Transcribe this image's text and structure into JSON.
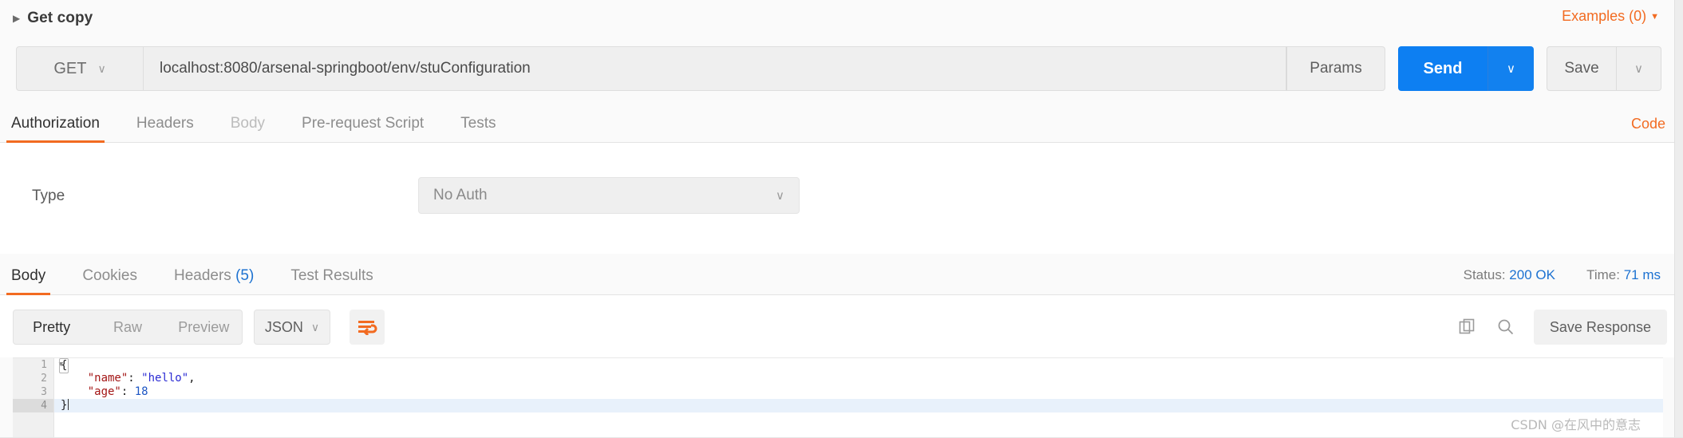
{
  "request": {
    "title": "Get copy",
    "collapse_caret": "▶",
    "examples_label": "Examples (0)",
    "examples_caret": "▼",
    "method": "GET",
    "method_caret": "∨",
    "url": "localhost:8080/arsenal-springboot/env/stuConfiguration",
    "params_label": "Params",
    "send_label": "Send",
    "send_caret": "∨",
    "save_label": "Save",
    "save_caret": "∨",
    "tabs": [
      {
        "label": "Authorization",
        "state": "active"
      },
      {
        "label": "Headers",
        "state": "normal"
      },
      {
        "label": "Body",
        "state": "dim"
      },
      {
        "label": "Pre-request Script",
        "state": "normal"
      },
      {
        "label": "Tests",
        "state": "normal"
      }
    ],
    "code_link": "Code"
  },
  "auth": {
    "type_label": "Type",
    "type_value": "No Auth",
    "type_caret": "∨"
  },
  "response": {
    "tabs": [
      {
        "label": "Body",
        "count": "",
        "state": "active"
      },
      {
        "label": "Cookies",
        "count": "",
        "state": "normal"
      },
      {
        "label": "Headers",
        "count": "(5)",
        "state": "normal"
      },
      {
        "label": "Test Results",
        "count": "",
        "state": "normal"
      }
    ],
    "status_key": "Status:",
    "status_value": "200 OK",
    "time_key": "Time:",
    "time_value": "71 ms",
    "view_modes": [
      {
        "label": "Pretty",
        "state": "active"
      },
      {
        "label": "Raw",
        "state": "normal"
      },
      {
        "label": "Preview",
        "state": "normal"
      }
    ],
    "format_value": "JSON",
    "format_caret": "∨",
    "save_response_label": "Save Response",
    "body_lines": [
      {
        "num": "1",
        "text": "{",
        "type": "open-brace",
        "current": false,
        "foldable": true
      },
      {
        "num": "2",
        "text": "    \"name\": \"hello\",",
        "type": "pair-string",
        "current": false,
        "foldable": false
      },
      {
        "num": "3",
        "text": "    \"age\": 18",
        "type": "pair-number",
        "current": false,
        "foldable": false
      },
      {
        "num": "4",
        "text": "}",
        "type": "close-brace",
        "current": true,
        "foldable": false
      }
    ],
    "line2_key": "\"name\"",
    "line2_value": "\"hello\"",
    "line3_key": "\"age\"",
    "line3_value": "18"
  },
  "watermark": "CSDN @在风中的意志",
  "colors": {
    "accent_orange": "#f26b21",
    "accent_blue": "#0d7ff2",
    "status_blue": "#1d72d1",
    "panel_gray": "#efefef"
  }
}
